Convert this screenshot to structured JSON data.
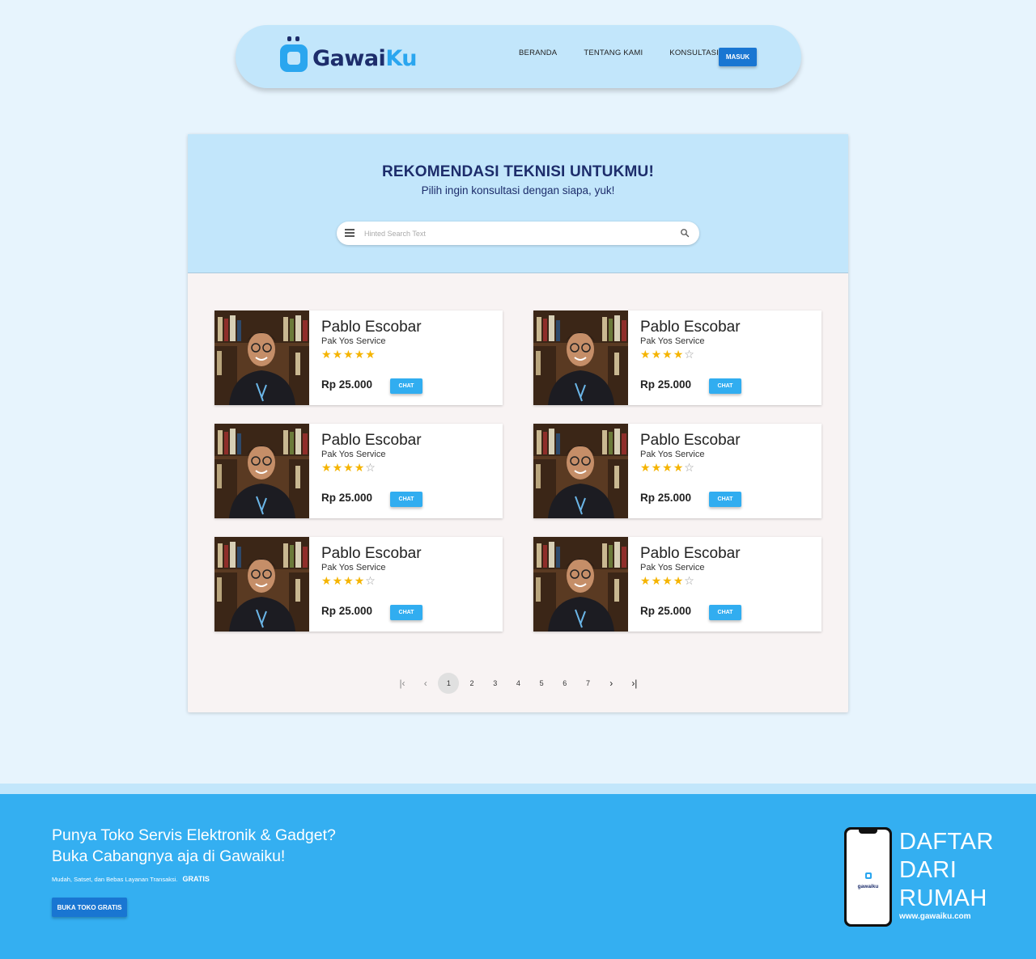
{
  "brand": {
    "logo_part1": "Gawai",
    "logo_part2": "Ku",
    "primary_color": "#1976d2",
    "accent_color": "#34aff1",
    "navy_color": "#1d2d6b",
    "light_color": "#c2e6fb"
  },
  "nav": {
    "links": [
      "BERANDA",
      "TENTANG KAMI",
      "KONSULTASI"
    ],
    "login_label": "MASUK"
  },
  "hero": {
    "title": "REKOMENDASI TEKNISI UNTUKMU!",
    "subtitle": "Pilih ingin konsultasi dengan siapa, yuk!",
    "search_placeholder": "Hinted Search Text"
  },
  "technicians": [
    {
      "name": "Pablo Escobar",
      "shop": "Pak Yos Service",
      "rating": 5,
      "price": "Rp 25.000",
      "chat_label": "CHAT"
    },
    {
      "name": "Pablo Escobar",
      "shop": "Pak Yos Service",
      "rating": 4,
      "price": "Rp 25.000",
      "chat_label": "CHAT"
    },
    {
      "name": "Pablo Escobar",
      "shop": "Pak Yos Service",
      "rating": 4,
      "price": "Rp 25.000",
      "chat_label": "CHAT"
    },
    {
      "name": "Pablo Escobar",
      "shop": "Pak Yos Service",
      "rating": 4,
      "price": "Rp 25.000",
      "chat_label": "CHAT"
    },
    {
      "name": "Pablo Escobar",
      "shop": "Pak Yos Service",
      "rating": 4,
      "price": "Rp 25.000",
      "chat_label": "CHAT"
    },
    {
      "name": "Pablo Escobar",
      "shop": "Pak Yos Service",
      "rating": 4,
      "price": "Rp 25.000",
      "chat_label": "CHAT"
    }
  ],
  "pagination": {
    "pages": [
      "1",
      "2",
      "3",
      "4",
      "5",
      "6",
      "7"
    ],
    "current": "1",
    "first_icon": "first-page-icon",
    "prev_icon": "chevron-left-icon",
    "next_icon": "chevron-right-icon",
    "last_icon": "last-page-icon"
  },
  "footer": {
    "line1": "Punya Toko Servis Elektronik & Gadget?",
    "line2": "Buka Cabangnya aja di Gawaiku!",
    "tagline": "Mudah, Satset, dan Bebas Layanan Transaksi.",
    "tagline_bold": "GRATIS",
    "cta_label": "BUKA TOKO GRATIS",
    "phone_logo": "gawaiku",
    "promo_lines": [
      "DAFTAR",
      "DARI",
      "RUMAH"
    ],
    "website": "www.gawaiku.com"
  }
}
